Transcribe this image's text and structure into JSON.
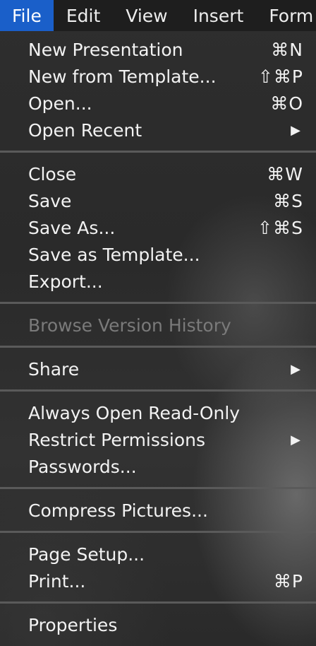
{
  "menubar": {
    "items": [
      {
        "label": "File"
      },
      {
        "label": "Edit"
      },
      {
        "label": "View"
      },
      {
        "label": "Insert"
      },
      {
        "label": "Form"
      }
    ]
  },
  "file_menu": {
    "new_presentation": {
      "label": "New Presentation",
      "shortcut": "⌘N"
    },
    "new_from_template": {
      "label": "New from Template...",
      "shortcut": "⇧⌘P"
    },
    "open": {
      "label": "Open...",
      "shortcut": "⌘O"
    },
    "open_recent": {
      "label": "Open Recent",
      "arrow": "▶"
    },
    "close": {
      "label": "Close",
      "shortcut": "⌘W"
    },
    "save": {
      "label": "Save",
      "shortcut": "⌘S"
    },
    "save_as": {
      "label": "Save As...",
      "shortcut": "⇧⌘S"
    },
    "save_as_template": {
      "label": "Save as Template..."
    },
    "export": {
      "label": "Export..."
    },
    "browse_version_history": {
      "label": "Browse Version History",
      "disabled": true
    },
    "share": {
      "label": "Share",
      "arrow": "▶"
    },
    "always_open_read_only": {
      "label": "Always Open Read-Only"
    },
    "restrict_permissions": {
      "label": "Restrict Permissions",
      "arrow": "▶"
    },
    "passwords": {
      "label": "Passwords..."
    },
    "compress_pictures": {
      "label": "Compress Pictures..."
    },
    "page_setup": {
      "label": "Page Setup..."
    },
    "print": {
      "label": "Print...",
      "shortcut": "⌘P"
    },
    "properties": {
      "label": "Properties"
    }
  },
  "colors": {
    "menubar_active": "#1a5fc9",
    "text": "#f2f2f2",
    "disabled_text": "#7a7a7a"
  }
}
